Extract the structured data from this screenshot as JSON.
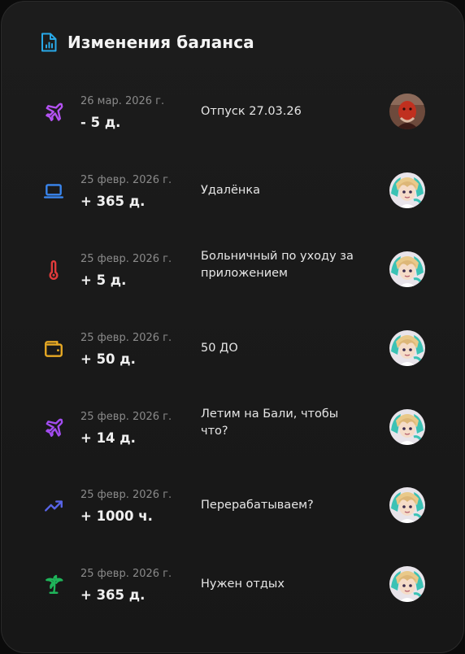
{
  "header": {
    "title": "Изменения баланса",
    "icon": "report-document-icon",
    "icon_color": "#29a9e8"
  },
  "transactions": [
    {
      "date": "26 мар. 2026 г.",
      "amount": "- 5 д.",
      "description": "Отпуск 27.03.26",
      "icon": "airplane-icon",
      "color": "#b452f2",
      "avatar": "avatar-red"
    },
    {
      "date": "25 февр. 2026 г.",
      "amount": "+ 365 д.",
      "description": "Удалёнка",
      "icon": "laptop-icon",
      "color": "#3a86ee",
      "avatar": "avatar-anime"
    },
    {
      "date": "25 февр. 2026 г.",
      "amount": "+ 5 д.",
      "description": "Больничный по уходу за приложением",
      "icon": "thermometer-icon",
      "color": "#e23b3b",
      "avatar": "avatar-anime"
    },
    {
      "date": "25 февр. 2026 г.",
      "amount": "+ 50 д.",
      "description": "50 ДО",
      "icon": "wallet-icon",
      "color": "#e7a924",
      "avatar": "avatar-anime"
    },
    {
      "date": "25 февр. 2026 г.",
      "amount": "+ 14 д.",
      "description": "Летим на Бали, чтобы что?",
      "icon": "airplane-icon",
      "color": "#a24cf0",
      "avatar": "avatar-anime"
    },
    {
      "date": "25 февр. 2026 г.",
      "amount": "+ 1000 ч.",
      "description": "Перерабатываем?",
      "icon": "trending-up-icon",
      "color": "#5865e8",
      "avatar": "avatar-anime"
    },
    {
      "date": "25 февр. 2026 г.",
      "amount": "+ 365 д.",
      "description": "Нужен отдых",
      "icon": "palm-tree-icon",
      "color": "#1fb45a",
      "avatar": "avatar-anime"
    }
  ]
}
